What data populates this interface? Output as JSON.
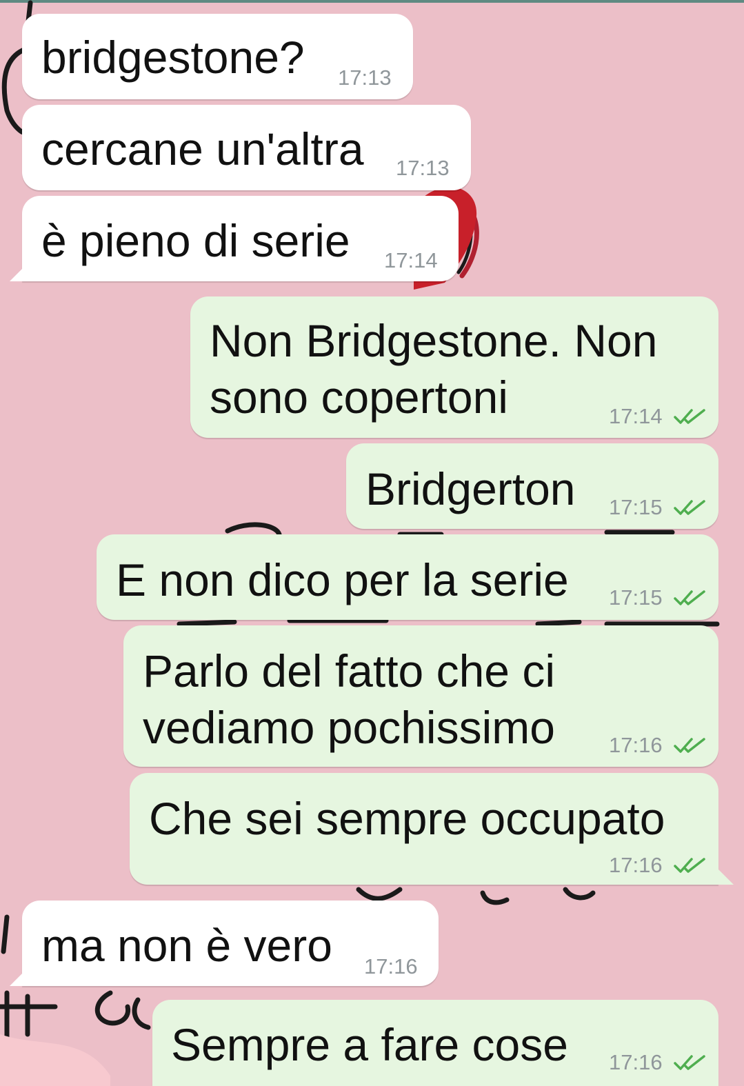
{
  "colors": {
    "wallpaper": "#ecbfc8",
    "incoming_bubble": "#ffffff",
    "outgoing_bubble": "#e6f6e0",
    "read_ticks": "#4fae4f",
    "timestamp": "#8f969a"
  },
  "messages": [
    {
      "direction": "incoming",
      "text": "bridgestone?",
      "time": "17:13"
    },
    {
      "direction": "incoming",
      "text": "cercane un'altra",
      "time": "17:13"
    },
    {
      "direction": "incoming",
      "text": "è pieno di serie",
      "time": "17:14"
    },
    {
      "direction": "outgoing",
      "lines": [
        "Non Bridgestone. Non",
        "sono copertoni"
      ],
      "time": "17:14",
      "status": "read"
    },
    {
      "direction": "outgoing",
      "text": "Bridgerton",
      "time": "17:15",
      "status": "read"
    },
    {
      "direction": "outgoing",
      "text": "E non dico per la serie",
      "time": "17:15",
      "status": "read"
    },
    {
      "direction": "outgoing",
      "lines": [
        "Parlo del fatto che ci",
        "vediamo pochissimo"
      ],
      "time": "17:16",
      "status": "read"
    },
    {
      "direction": "outgoing",
      "text": "Che sei sempre occupato",
      "time": "17:16",
      "status": "read"
    },
    {
      "direction": "incoming",
      "text": "ma non è vero",
      "time": "17:16"
    },
    {
      "direction": "outgoing",
      "text": "Sempre a fare cose",
      "time": "17:16",
      "status": "read"
    }
  ],
  "icons": {
    "read_status": "double-check-icon"
  }
}
